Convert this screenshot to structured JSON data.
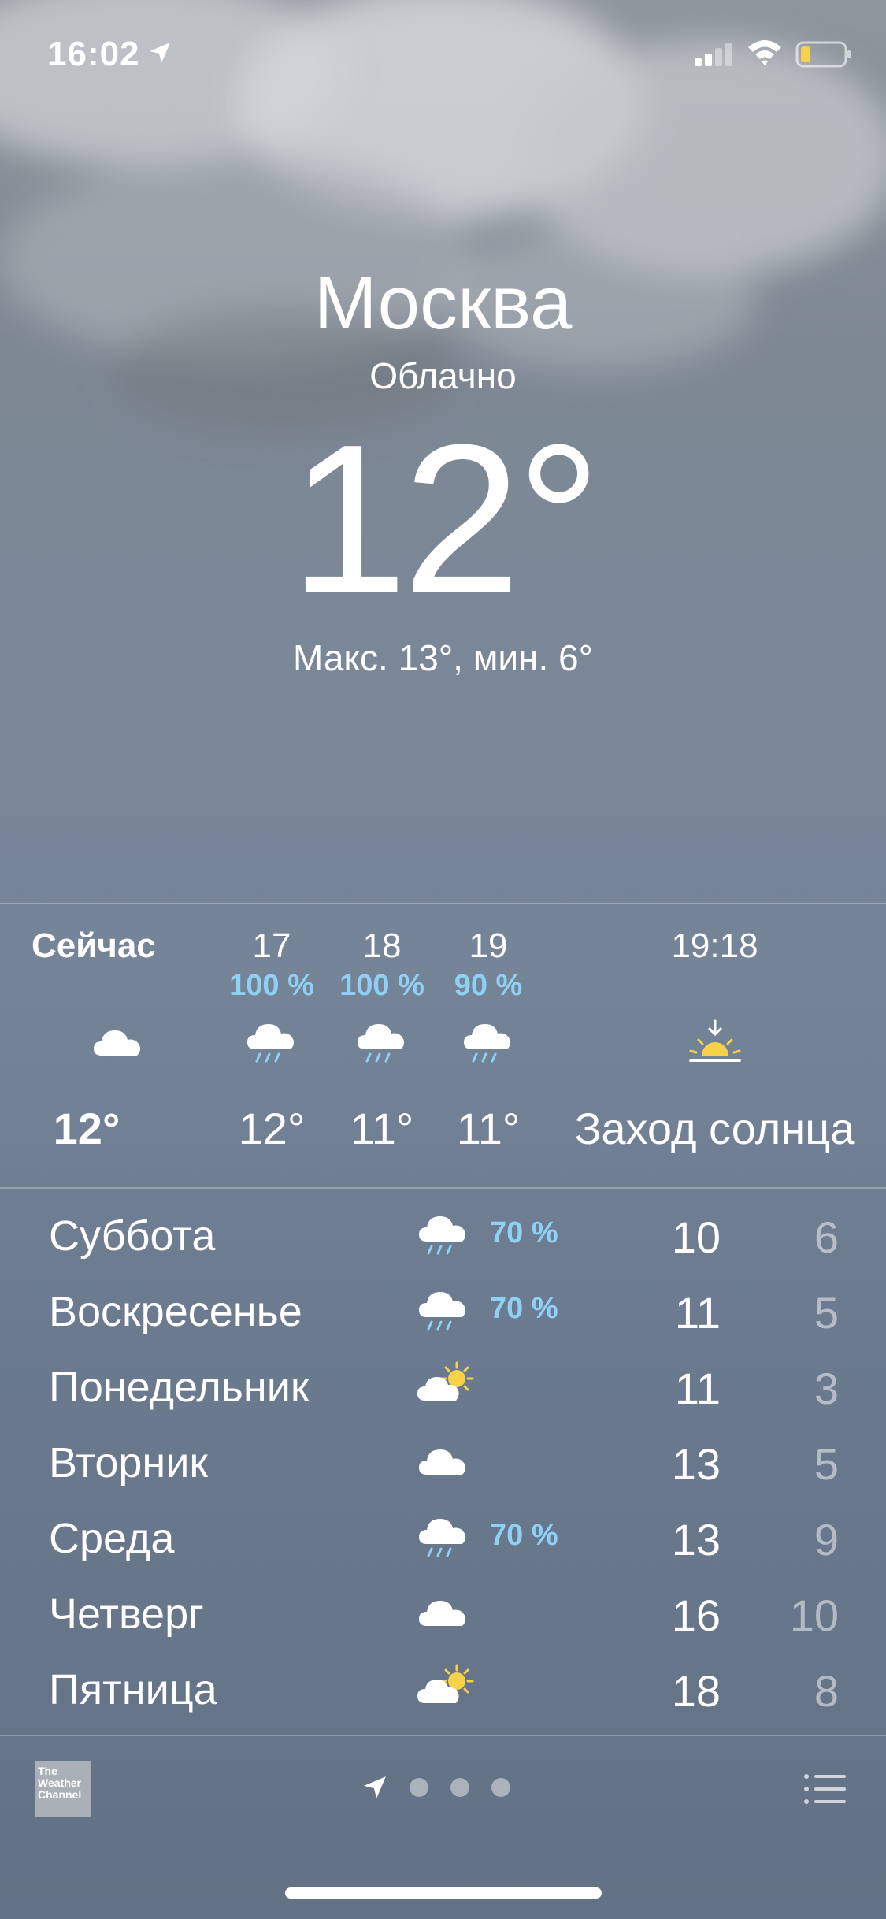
{
  "status_bar": {
    "time": "16:02"
  },
  "current": {
    "city": "Москва",
    "condition": "Облачно",
    "temperature": "12°",
    "high_low": "Макс. 13°, мин. 6°"
  },
  "hourly": [
    {
      "label": "Сейчас",
      "precip": "",
      "icon": "cloud-icon",
      "temp": "12°"
    },
    {
      "label": "17",
      "precip": "100 %",
      "icon": "rain-cloud-icon",
      "temp": "12°"
    },
    {
      "label": "18",
      "precip": "100 %",
      "icon": "rain-cloud-icon",
      "temp": "11°"
    },
    {
      "label": "19",
      "precip": "90 %",
      "icon": "rain-cloud-icon",
      "temp": "11°"
    },
    {
      "label": "19:18",
      "precip": "",
      "icon": "sunset-icon",
      "temp": "Заход солнца"
    }
  ],
  "daily": [
    {
      "day": "Суббота",
      "icon": "rain-cloud-icon",
      "precip": "70 %",
      "high": "10",
      "low": "6"
    },
    {
      "day": "Воскресенье",
      "icon": "rain-cloud-icon",
      "precip": "70 %",
      "high": "11",
      "low": "5"
    },
    {
      "day": "Понедельник",
      "icon": "partly-sunny-icon",
      "precip": "",
      "high": "11",
      "low": "3"
    },
    {
      "day": "Вторник",
      "icon": "cloud-icon",
      "precip": "",
      "high": "13",
      "low": "5"
    },
    {
      "day": "Среда",
      "icon": "rain-cloud-icon",
      "precip": "70 %",
      "high": "13",
      "low": "9"
    },
    {
      "day": "Четверг",
      "icon": "cloud-icon",
      "precip": "",
      "high": "16",
      "low": "10"
    },
    {
      "day": "Пятница",
      "icon": "partly-sunny-icon",
      "precip": "",
      "high": "18",
      "low": "8"
    }
  ],
  "footer": {
    "weather_channel_logo": "The Weather Channel",
    "page_count": 3
  },
  "colors": {
    "precip_text": "#8fd0f5",
    "sun_yellow": "#f5d24a",
    "background_top": "#8f969c",
    "background_bottom": "#637184"
  }
}
